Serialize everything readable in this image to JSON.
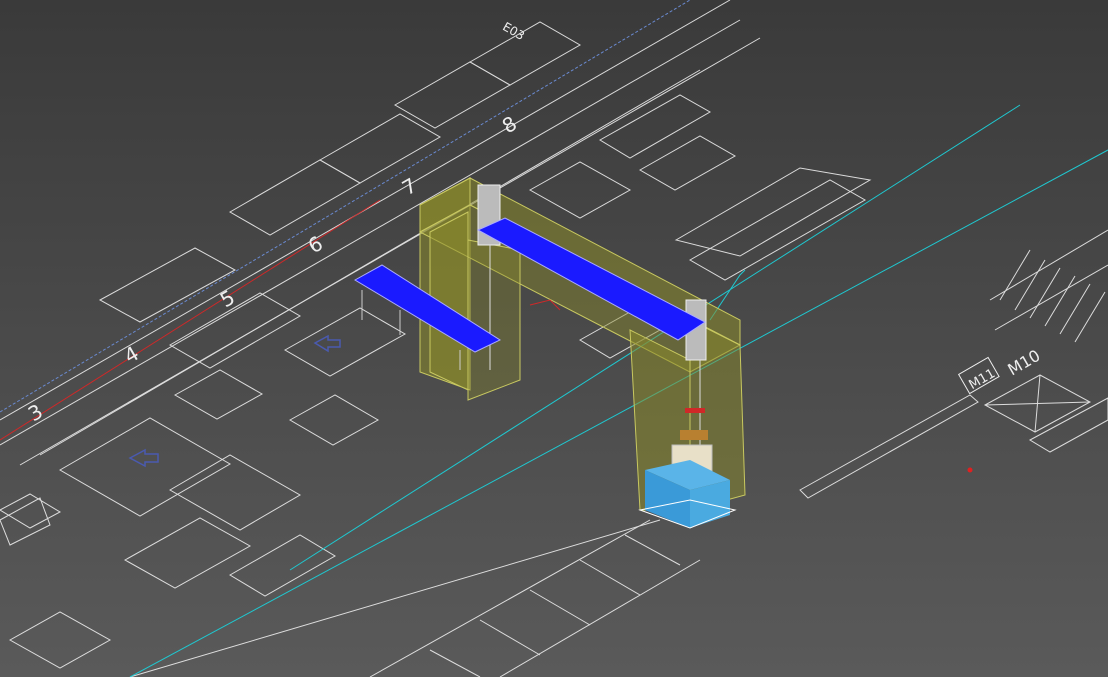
{
  "viewport": {
    "background_top": "#3a3a3a",
    "background_bottom": "#5a5a5a"
  },
  "colors": {
    "outline": "#ececec",
    "guide_cyan": "#1fc8d0",
    "axis_red": "#d02828",
    "frame_fill": "#8a8a2a",
    "frame_edge": "#c8c860",
    "conveyor_blue": "#1a1aff",
    "box_blue": "#3aa0e0",
    "arrow_blue": "#4a5ab0",
    "marker_red": "#e02020"
  },
  "labels": {
    "grid_3": "3",
    "grid_4": "4",
    "grid_5": "5",
    "grid_6": "6",
    "grid_7": "7",
    "grid_8": "8",
    "area_code": "E03",
    "zone_m10": "M10",
    "zone_m11": "M11"
  }
}
